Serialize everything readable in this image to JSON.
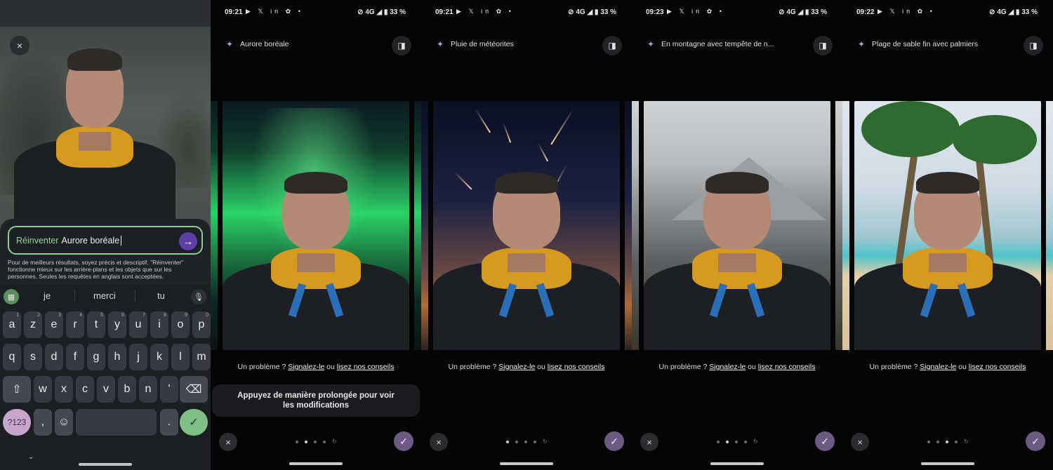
{
  "editor": {
    "prompt_prefix": "Réinventer",
    "prompt_value": "Aurore boréale",
    "hint": "Pour de meilleurs résultats, soyez précis et descriptif. \"Réinventer\" fonctionne mieux sur les arrière-plans et les objets que sur les personnes. Seules les requêtes en anglais sont acceptées.",
    "close_icon": "×",
    "send_icon": "→"
  },
  "keyboard": {
    "suggestions": [
      "je",
      "merci",
      "tu"
    ],
    "row1": [
      [
        "a",
        "1"
      ],
      [
        "z",
        "2"
      ],
      [
        "e",
        "3"
      ],
      [
        "r",
        "4"
      ],
      [
        "t",
        "5"
      ],
      [
        "y",
        "6"
      ],
      [
        "u",
        "7"
      ],
      [
        "i",
        "8"
      ],
      [
        "o",
        "9"
      ],
      [
        "p",
        "0"
      ]
    ],
    "row2": [
      "q",
      "s",
      "d",
      "f",
      "g",
      "h",
      "j",
      "k",
      "l",
      "m"
    ],
    "row3": [
      "w",
      "x",
      "c",
      "v",
      "b",
      "n",
      "'"
    ],
    "sym_label": "?123",
    "comma": ",",
    "period": ".",
    "shift_icon": "⇧",
    "backspace_icon": "⌫",
    "emoji_icon": "☺",
    "enter_icon": "✓",
    "apps_icon": "▦",
    "mic_icon": "🎙",
    "hide_icon": "⌄"
  },
  "screens": [
    {
      "time": "09:21",
      "apps": "▶ 𝕏 in ✿ •",
      "status": "⊘ 4G ◢ ▮ 33 %",
      "title": "Aurore boréale",
      "theme": "aurora"
    },
    {
      "time": "09:21",
      "apps": "▶ 𝕏 in ✿ •",
      "status": "⊘ 4G ◢ ▮ 33 %",
      "title": "Pluie de météorites",
      "theme": "meteor"
    },
    {
      "time": "09:23",
      "apps": "▶ 𝕏 in ✿ •",
      "status": "⊘ 4G ◢ ▮ 33 %",
      "title": "En montagne avec tempête de n...",
      "theme": "mountain"
    },
    {
      "time": "09:22",
      "apps": "▶ 𝕏 in ✿ •",
      "status": "⊘ 4G ◢ ▮ 33 %",
      "title": "Plage de sable fin avec palmiers",
      "theme": "beach"
    }
  ],
  "feedback": {
    "prefix": "Un problème ?",
    "report_link": "Signalez-le",
    "middle": "ou",
    "tips_link": "lisez nos conseils"
  },
  "toast": "Appuyez de manière prolongée pour voir les modifications",
  "icons": {
    "sparkle": "✦",
    "compare": "◨",
    "discard": "×",
    "confirm": "✓",
    "refresh": "↻"
  },
  "active_dot": [
    1,
    0,
    1,
    2
  ],
  "colors": {
    "accent_green": "#8ccf94",
    "send_purple": "#5b3fa6",
    "confirm_purple": "#6d5a82",
    "hood_yellow": "#d79a1f"
  }
}
